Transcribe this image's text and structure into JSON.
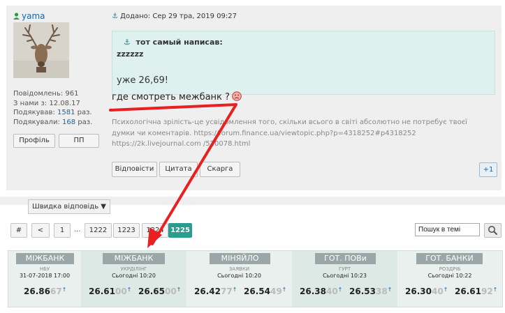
{
  "user": {
    "name": "yama",
    "stats": [
      {
        "label": "Повідомлень:",
        "value": "961"
      },
      {
        "label": "З нами з:",
        "value": "12.08.17"
      },
      {
        "label": "Подякував:",
        "value": "1581",
        "suffix": "раз."
      },
      {
        "label": "Подякували:",
        "value": "168",
        "suffix": "раз."
      }
    ],
    "profile_button": "Профіль",
    "pm_button": "ПП"
  },
  "post": {
    "posted": "Додано: Сер 29 тра, 2019 09:27",
    "quote_author": "тот самый написав:",
    "quote_line1": "zzzzzz",
    "quote_line2": "уже 26,69!",
    "message": "где смотреть межбанк ?",
    "signature": "Психологічна зрілість-це усвідомлення того, скільки всього в світі абсолютно не потребує твоєї думки чи коментарів. https://forum.finance.ua/viewtopic.php?p=4318252#p4318252 https://2k.livejournal.com /520078.html",
    "actions": [
      "Відповісти",
      "Цитата",
      "Скарга"
    ],
    "plus_one": "+1"
  },
  "quick_reply": "Швидка відповідь ▼",
  "pagination": {
    "hash": "#",
    "prev": "<",
    "first": "1",
    "ellipsis": "...",
    "pages": [
      "1222",
      "1223",
      "1224"
    ],
    "current": "1225"
  },
  "search": {
    "placeholder": "Пошук в темі"
  },
  "ticker": [
    {
      "title": "МІЖБАНК",
      "sub": "НБУ",
      "date": "31-07-2018 17:00",
      "rates": [
        {
          "main": "26.86",
          "tail": "67",
          "arrow": "↑"
        }
      ]
    },
    {
      "title": "МІЖБАНК",
      "sub": "УКРДІЛІНГ",
      "date": "Сьогодні 10:20",
      "rates": [
        {
          "main": "26.61",
          "tail": "00",
          "arrow": "↑"
        },
        {
          "main": "26.65",
          "tail": "00",
          "arrow": "↑"
        }
      ]
    },
    {
      "title": "МІНЯЙЛО",
      "sub": "ЗАЯВКИ",
      "date": "Сьогодні 10:20",
      "rates": [
        {
          "main": "26.42",
          "tail": "77",
          "arrow": "↑"
        },
        {
          "main": "26.54",
          "tail": "49",
          "arrow": "↑"
        }
      ]
    },
    {
      "title": "ГОТ. ПОВи",
      "sub": "ГУРТ",
      "date": "Сьогодні 10:23",
      "rates": [
        {
          "main": "26.38",
          "tail": "40",
          "arrow": "↑"
        },
        {
          "main": "26.53",
          "tail": "38",
          "arrow": "↑"
        }
      ]
    },
    {
      "title": "ГОТ. БАНКИ",
      "sub": "РОЗДРІБ",
      "date": "Сьогодні 10:22",
      "rates": [
        {
          "main": "26.30",
          "tail": "40",
          "arrow": "↑"
        },
        {
          "main": "26.61",
          "tail": "92",
          "arrow": "↑"
        }
      ]
    }
  ],
  "colors": {
    "accent": "#2a9d8f",
    "link": "#1565a8",
    "annotation": "#e82020"
  }
}
